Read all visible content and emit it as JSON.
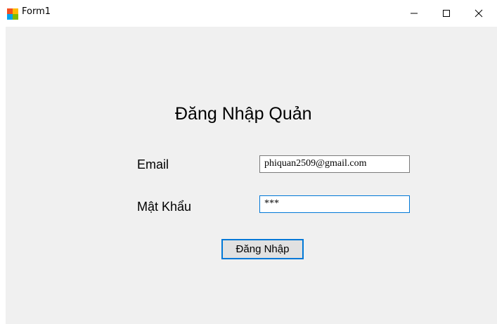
{
  "window": {
    "title": "Form1",
    "icon": "winforms-app-icon",
    "controls": [
      "minimize-icon",
      "maximize-icon",
      "close-icon"
    ]
  },
  "form": {
    "heading": "Đăng Nhập Quản",
    "email_label": "Email",
    "email_value": "phiquan2509@gmail.com",
    "password_label": "Mật Khẩu",
    "password_value": "***",
    "login_button": "Đăng Nhập"
  },
  "colors": {
    "background": "#f0f0f0",
    "focus_accent": "#0078d7"
  }
}
